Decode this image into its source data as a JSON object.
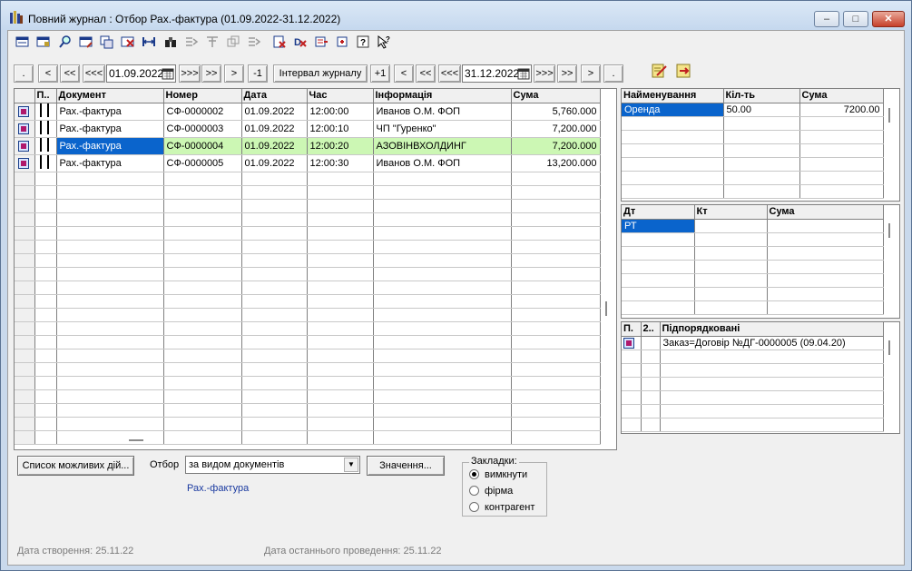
{
  "window": {
    "title": "Повний журнал : Отбор Рах.-фактура (01.09.2022-31.12.2022)",
    "controls": [
      "minimize",
      "maximize",
      "close"
    ]
  },
  "toolbar": {
    "icons": [
      "new-doc-icon",
      "new-copy-icon",
      "find-icon",
      "edit-icon",
      "copy-icon",
      "delete-icon",
      "range-icon",
      "search-binoculars-icon",
      "post-icon",
      "unpost-icon",
      "move-icon",
      "move-down-icon",
      "journal-icon",
      "cancel-post-icon",
      "delete-marked-icon",
      "structure-icon",
      "tree-icon",
      "help-icon",
      "help-pointer-icon"
    ]
  },
  "nav": {
    "dot_left": ".",
    "prev": "<",
    "prev_fast": "<<",
    "prev_faster": "<<<",
    "start_date": "01.09.2022",
    "next_faster": ">>>",
    "next_fast": ">>",
    "next": ">",
    "minus_one": "-1",
    "interval_label": "Інтервал журналу",
    "plus_one": "+1",
    "prev2": "<",
    "prev_fast2": "<<",
    "prev_faster2": "<<<",
    "end_date": "31.12.2022",
    "next_faster2": ">>>",
    "next_fast2": ">>",
    "next2": ">",
    "dot_right": "."
  },
  "journal": {
    "headers": [
      "П..",
      "Документ",
      "Номер",
      "Дата",
      "Час",
      "Інформація",
      "Сума"
    ],
    "rows": [
      {
        "doc": "Рах.-фактура",
        "num": "СФ-0000002",
        "date": "01.09.2022",
        "time": "12:00:00",
        "info": "Иванов О.М. ФОП",
        "sum": "5,760.000"
      },
      {
        "doc": "Рах.-фактура",
        "num": "СФ-0000003",
        "date": "01.09.2022",
        "time": "12:00:10",
        "info": "ЧП \"Гуренко\"",
        "sum": "7,200.000"
      },
      {
        "doc": "Рах.-фактура",
        "num": "СФ-0000004",
        "date": "01.09.2022",
        "time": "12:00:20",
        "info": "АЗОВІНВХОЛДИНГ",
        "sum": "7,200.000"
      },
      {
        "doc": "Рах.-фактура",
        "num": "СФ-0000005",
        "date": "01.09.2022",
        "time": "12:00:30",
        "info": "Иванов О.М. ФОП",
        "sum": "13,200.000"
      }
    ],
    "selected_index": 2
  },
  "items": {
    "headers": [
      "Найменування",
      "Кіл-ть",
      "Сума"
    ],
    "rows": [
      {
        "name": "Оренда",
        "qty": "50.00",
        "sum": "7200.00"
      }
    ]
  },
  "entries": {
    "headers": [
      "Дт",
      "Кт",
      "Сума"
    ],
    "rows": [
      {
        "dt": "РТ",
        "kt": "",
        "sum": ""
      }
    ]
  },
  "subordinate": {
    "headers": [
      "П.",
      "2..",
      "Підпорядковані"
    ],
    "rows": [
      {
        "text": "Заказ=Договір №ДГ-0000005 (09.04.20)"
      }
    ]
  },
  "bottom": {
    "actions_button": "Список можливих дій...",
    "filter_label": "Отбор",
    "filter_value": "за видом документів",
    "values_button": "Значення...",
    "filter_result": "Рах.-фактура",
    "bookmarks_label": "Закладки:",
    "bookmarks": [
      "вимкнути",
      "фірма",
      "контрагент"
    ],
    "bookmark_selected": 0
  },
  "status": {
    "created": "Дата створення: 25.11.22",
    "last_posted": "Дата останнього проведення: 25.11.22"
  },
  "colors": {
    "selection": "#0a64cc",
    "row_highlight": "#ccf7b4",
    "window_frame": "#c9d9ec"
  }
}
